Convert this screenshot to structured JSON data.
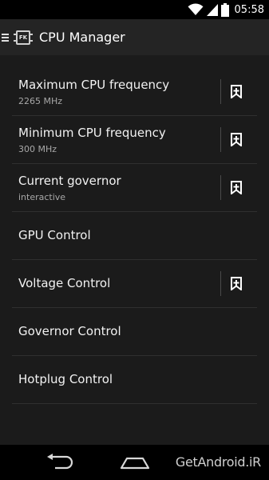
{
  "status_bar": {
    "time": "05:58"
  },
  "action_bar": {
    "title": "CPU Manager",
    "app_icon_text": "FK"
  },
  "settings": [
    {
      "title": "Maximum CPU frequency",
      "value": "2265 MHz",
      "pinnable": true
    },
    {
      "title": "Minimum CPU frequency",
      "value": "300 MHz",
      "pinnable": true
    },
    {
      "title": "Current governor",
      "value": "interactive",
      "pinnable": true
    },
    {
      "title": "GPU Control",
      "value": "",
      "pinnable": false
    },
    {
      "title": "Voltage Control",
      "value": "",
      "pinnable": true
    },
    {
      "title": "Governor Control",
      "value": "",
      "pinnable": false
    },
    {
      "title": "Hotplug Control",
      "value": "",
      "pinnable": false
    }
  ],
  "watermark": "GetAndroid.iR",
  "icons": {
    "drawer": "drawer-icon",
    "pin": "bookmark-plus-icon",
    "back": "back-icon",
    "home": "home-icon"
  }
}
